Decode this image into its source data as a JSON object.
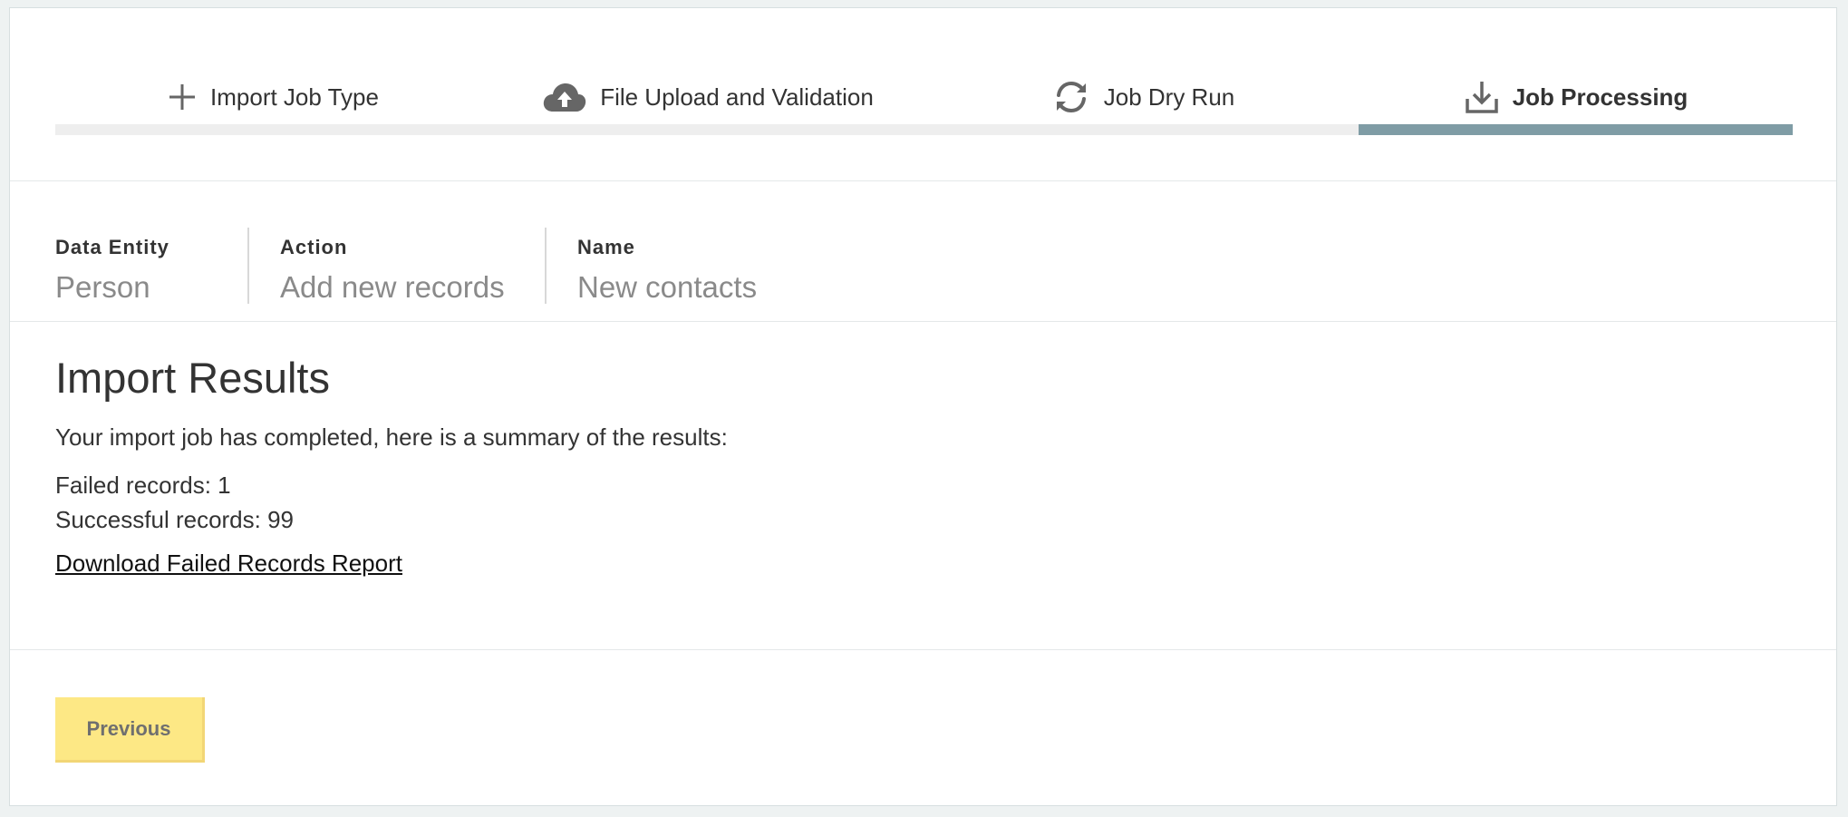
{
  "stepper": {
    "steps": [
      {
        "label": "Import Job Type",
        "icon": "plus-icon",
        "active": false
      },
      {
        "label": "File Upload and Validation",
        "icon": "cloud-upload-icon",
        "active": false
      },
      {
        "label": "Job Dry Run",
        "icon": "sync-icon",
        "active": false
      },
      {
        "label": "Job Processing",
        "icon": "download-icon",
        "active": true
      }
    ],
    "current_step": 4,
    "total_steps": 4,
    "progress_color": "#7f9ca5",
    "track_color": "#eeeeee"
  },
  "meta": {
    "data_entity": {
      "label": "Data Entity",
      "value": "Person"
    },
    "action": {
      "label": "Action",
      "value": "Add new records"
    },
    "name": {
      "label": "Name",
      "value": "New contacts"
    }
  },
  "results": {
    "title": "Import Results",
    "intro": "Your import job has completed, here is a summary of the results:",
    "failed": "Failed records: 1",
    "successful": "Successful records: 99",
    "report_link": "Download Failed Records Report"
  },
  "footer": {
    "previous_label": "Previous",
    "previous_color": "#fde885"
  }
}
